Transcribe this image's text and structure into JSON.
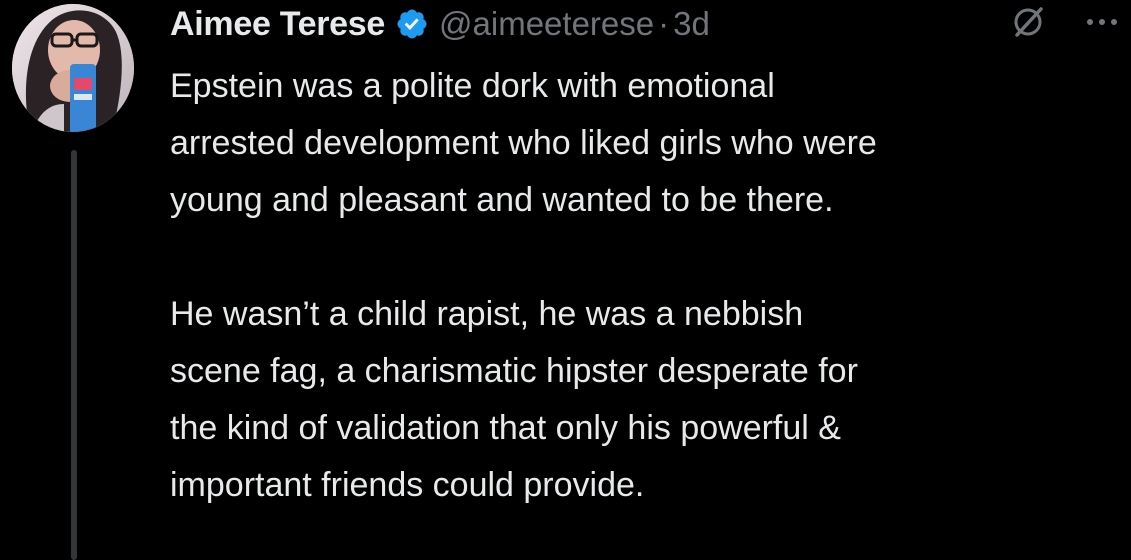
{
  "tweet": {
    "author": {
      "display_name": "Aimee Terese",
      "handle": "@aimeeterese",
      "verified": true,
      "avatar": "profile-photo"
    },
    "separator": "·",
    "time": "3d",
    "icons": {
      "verified": "verified-badge-icon",
      "grok": "grok-icon",
      "more": "more-icon"
    },
    "paragraphs": [
      "Epstein was a polite dork with emotional\narrested development who liked girls who were\nyoung and pleasant and wanted to be there.",
      "He wasn’t a child rapist, he was a nebbish\nscene fag, a charismatic hipster desperate for\nthe kind of validation that only his powerful &\nimportant friends could provide."
    ]
  },
  "colors": {
    "background": "#000000",
    "text": "#e7e9ea",
    "secondary_text": "#71767b",
    "verified_blue": "#1d9bf0",
    "thread_line": "#333639"
  }
}
